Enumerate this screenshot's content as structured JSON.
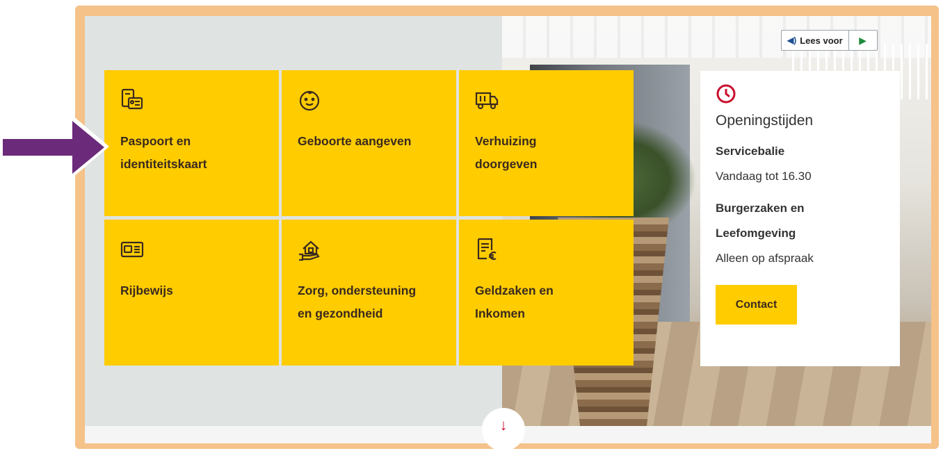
{
  "readspeaker": {
    "label": "Lees voor"
  },
  "tiles": [
    {
      "label_line1": "Paspoort en",
      "label_line2": "identiteitskaart",
      "icon": "passport-id-icon"
    },
    {
      "label_line1": "Geboorte aangeven",
      "label_line2": "",
      "icon": "baby-face-icon"
    },
    {
      "label_line1": "Verhuizing",
      "label_line2": "doorgeven",
      "icon": "moving-truck-icon"
    },
    {
      "label_line1": "Rijbewijs",
      "label_line2": "",
      "icon": "drivers-license-icon"
    },
    {
      "label_line1": "Zorg, ondersteuning",
      "label_line2": "en gezondheid",
      "icon": "house-care-hand-icon"
    },
    {
      "label_line1": "Geldzaken en",
      "label_line2": "Inkomen",
      "icon": "document-euro-icon"
    }
  ],
  "hours": {
    "title": "Openingstijden",
    "servicebalie_heading": "Servicebalie",
    "servicebalie_text": "Vandaag tot 16.30",
    "burgerzaken_heading_line1": "Burgerzaken en",
    "burgerzaken_heading_line2": "Leefomgeving",
    "burgerzaken_text": "Alleen op afspraak",
    "contact_label": "Contact"
  },
  "colors": {
    "tile": "#ffcc00",
    "frame": "#f5c28a",
    "annotation_arrow": "#6b2a7a",
    "clock": "#c8102e"
  }
}
